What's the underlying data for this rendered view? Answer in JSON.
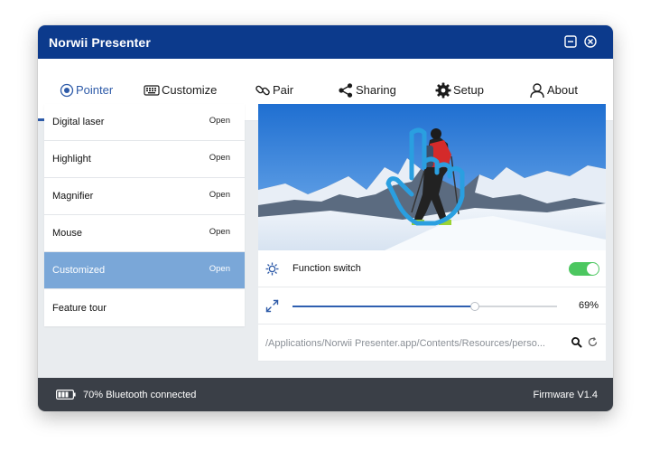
{
  "window": {
    "title": "Norwii Presenter"
  },
  "tabs": [
    {
      "label": "Pointer",
      "icon": "radio-target-icon",
      "active": true
    },
    {
      "label": "Customize",
      "icon": "keyboard-icon"
    },
    {
      "label": "Pair",
      "icon": "link-icon"
    },
    {
      "label": "Sharing",
      "icon": "share-icon"
    },
    {
      "label": "Setup",
      "icon": "gear-icon"
    },
    {
      "label": "About",
      "icon": "person-icon"
    }
  ],
  "sidebar": {
    "items": [
      {
        "label": "Digital laser",
        "action": "Open"
      },
      {
        "label": "Highlight",
        "action": "Open"
      },
      {
        "label": "Magnifier",
        "action": "Open"
      },
      {
        "label": "Mouse",
        "action": "Open"
      },
      {
        "label": "Customized",
        "action": "Open",
        "selected": true
      },
      {
        "label": "Feature tour",
        "action": ""
      }
    ]
  },
  "function_switch": {
    "label": "Function switch",
    "on": true
  },
  "size_slider": {
    "value": 69,
    "display": "69%"
  },
  "path": {
    "value": "/Applications/Norwii Presenter.app/Contents/Resources/perso..."
  },
  "status": {
    "bluetooth": "70% Bluetooth connected",
    "battery_level": 0.7,
    "firmware": "Firmware V1.4"
  },
  "colors": {
    "titlebar": "#0c3a8c",
    "accent": "#2d5aa8",
    "selected_item": "#7aa7d8",
    "toggle_on": "#4cc760",
    "statusbar": "#3a3f47"
  }
}
